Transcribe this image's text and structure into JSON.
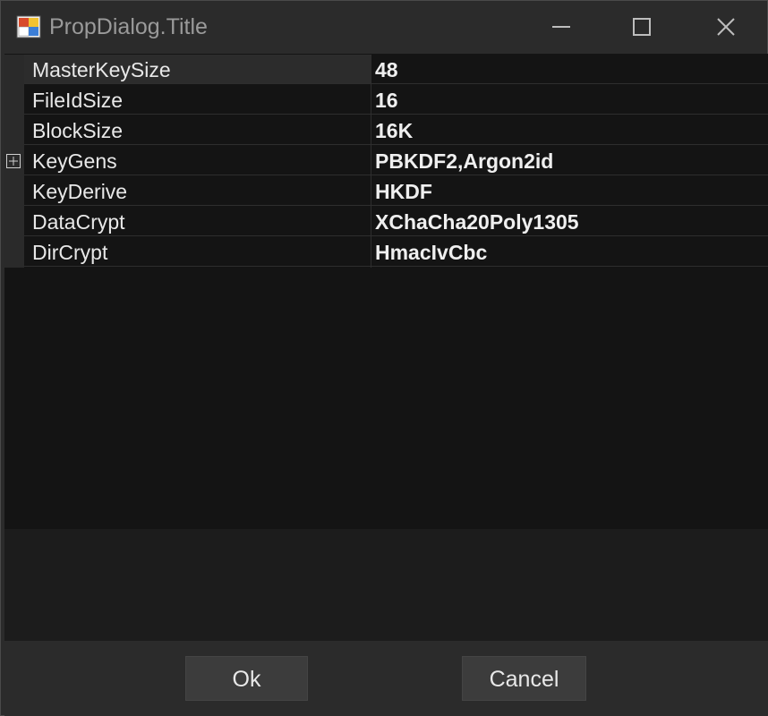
{
  "window": {
    "title": "PropDialog.Title",
    "icons": {
      "app": "app-icon",
      "minimize": "minimize-icon",
      "maximize": "maximize-icon",
      "close": "close-icon"
    }
  },
  "properties": [
    {
      "name": "MasterKeySize",
      "value": "48",
      "selected": true,
      "expandable": false
    },
    {
      "name": "FileIdSize",
      "value": "16",
      "selected": false,
      "expandable": false
    },
    {
      "name": "BlockSize",
      "value": "16K",
      "selected": false,
      "expandable": false
    },
    {
      "name": "KeyGens",
      "value": "PBKDF2,Argon2id",
      "selected": false,
      "expandable": true
    },
    {
      "name": "KeyDerive",
      "value": "HKDF",
      "selected": false,
      "expandable": false
    },
    {
      "name": "DataCrypt",
      "value": "XChaCha20Poly1305",
      "selected": false,
      "expandable": false
    },
    {
      "name": "DirCrypt",
      "value": "HmacIvCbc",
      "selected": false,
      "expandable": false
    }
  ],
  "buttons": {
    "ok": "Ok",
    "cancel": "Cancel"
  },
  "colors": {
    "background": "#2b2b2b",
    "grid": "#141414",
    "text": "#e6e6e6"
  }
}
